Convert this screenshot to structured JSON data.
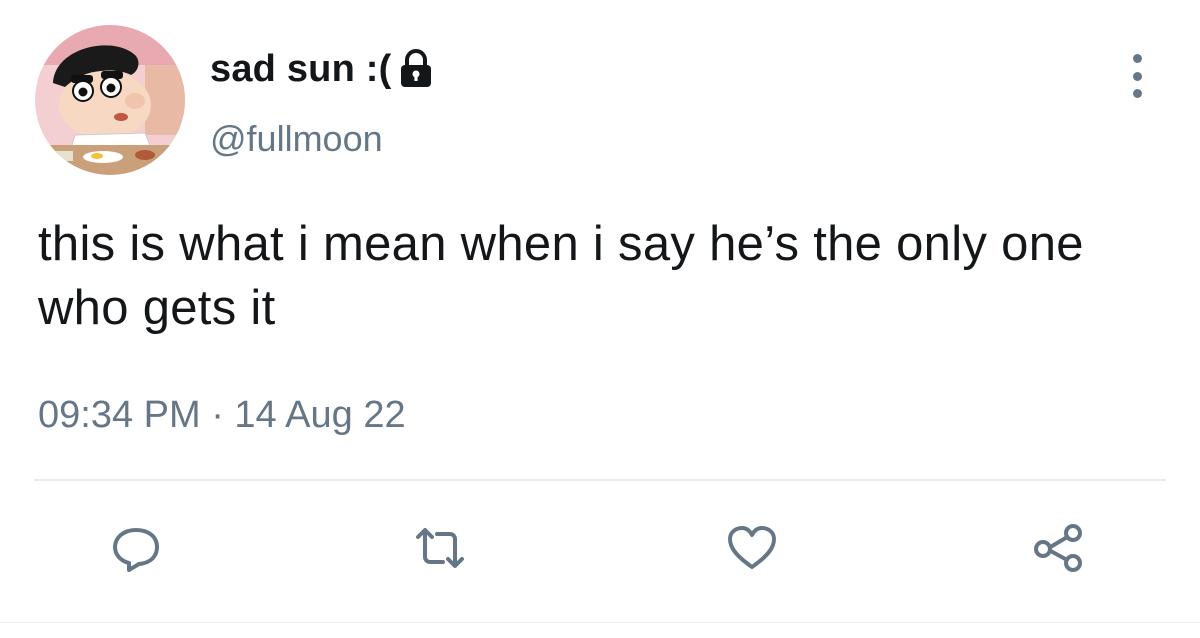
{
  "tweet": {
    "display_name": "sad sun :(",
    "handle": "@fullmoon",
    "text": "this is what i mean when i say he’s the only one who gets it",
    "timestamp": "09:34 PM · 14 Aug 22",
    "protected_account": true
  },
  "icons": {
    "lock": "lock-icon",
    "more": "more-vertical-icon",
    "reply": "reply-icon",
    "retweet": "retweet-icon",
    "like": "heart-icon",
    "share": "share-icon"
  },
  "colors": {
    "text_primary": "#14171a",
    "text_secondary": "#657786",
    "divider": "#e6ecf0",
    "background": "#ffffff"
  }
}
